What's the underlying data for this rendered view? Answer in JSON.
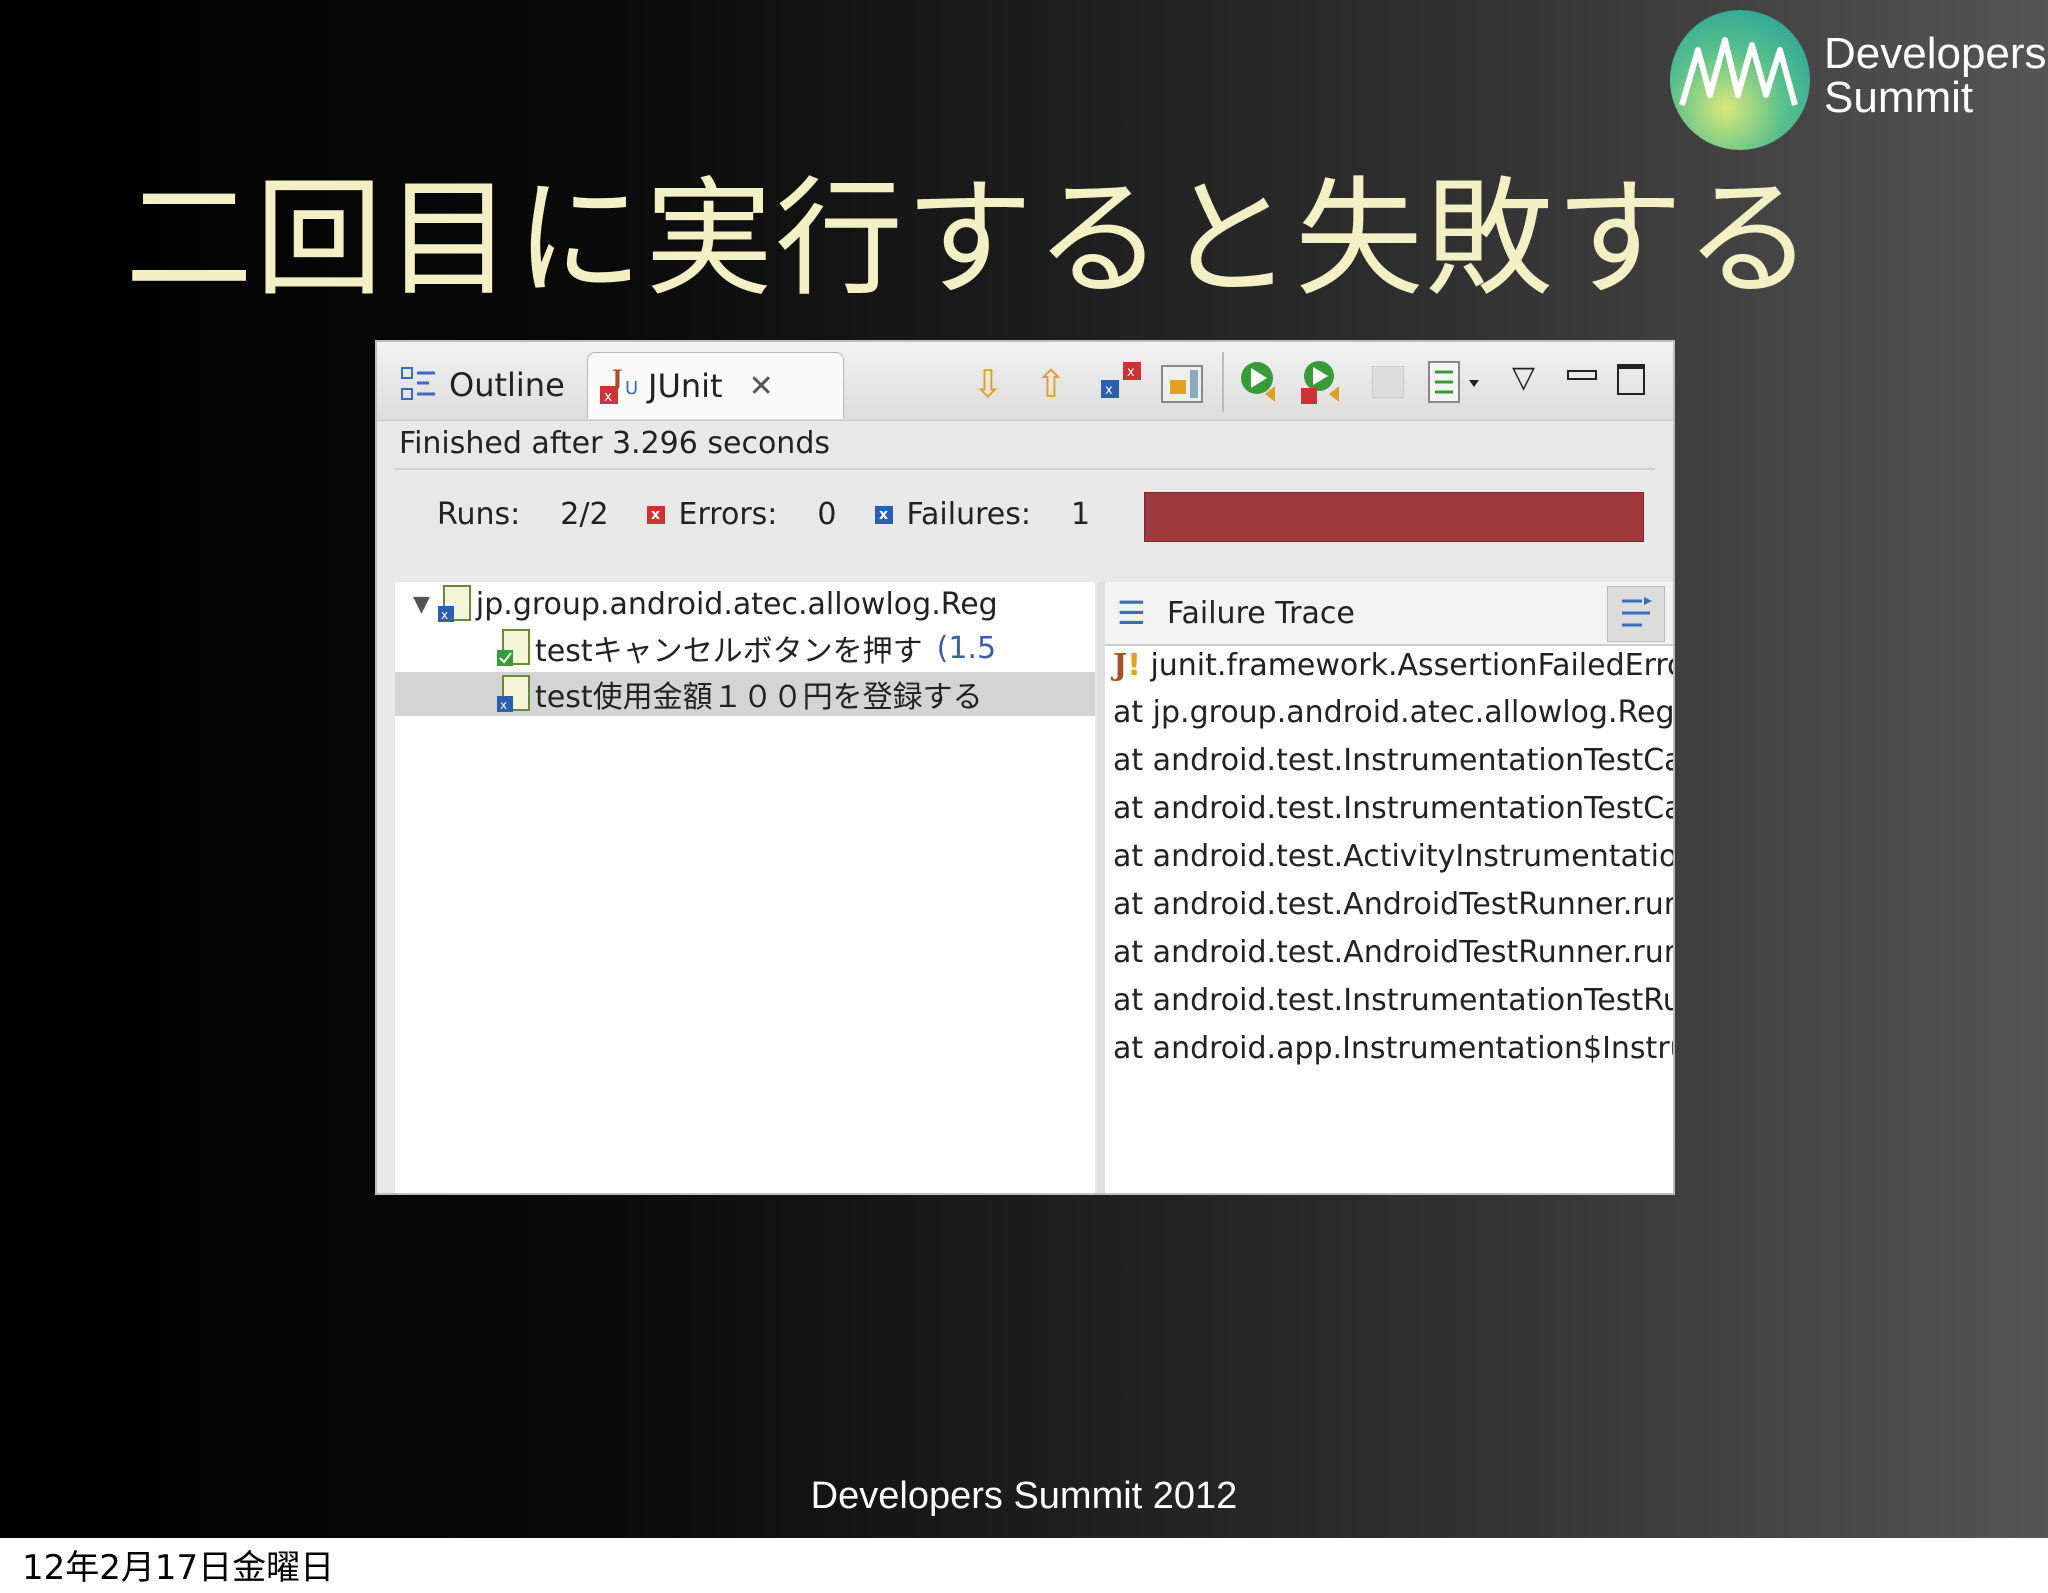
{
  "slide": {
    "title": "二回目に実行すると失敗する",
    "logo_line1": "Developers",
    "logo_line2": "Summit",
    "footer": "Developers Summit 2012",
    "date": "12年2月17日金曜日"
  },
  "panel": {
    "tabs": [
      {
        "label": "Outline",
        "icon": "outline-icon"
      },
      {
        "label": "JUnit",
        "icon": "junit-icon",
        "active": true
      }
    ],
    "status": "Finished after 3.296 seconds",
    "counters": {
      "runs_label": "Runs:",
      "runs_value": "2/2",
      "errors_label": "Errors:",
      "errors_value": "0",
      "failures_label": "Failures:",
      "failures_value": "1"
    },
    "progress": {
      "color": "#9e3a3e",
      "fraction": 1.0
    },
    "tree": [
      {
        "label": "jp.group.android.atec.allowlog.Reg",
        "type": "suite"
      },
      {
        "label": "testキャンセルボタンを押す",
        "time": "(1.5",
        "status": "pass"
      },
      {
        "label": "test使用金額１００円を登録する",
        "status": "fail",
        "selected": true
      }
    ],
    "failure_trace": {
      "title": "Failure Trace",
      "lines": [
        "junit.framework.AssertionFailedError:",
        "at jp.group.android.atec.allowlog.Registe",
        "at android.test.InstrumentationTestCase.",
        "at android.test.InstrumentationTestCase.",
        "at android.test.ActivityInstrumentationTe",
        "at android.test.AndroidTestRunner.runTe",
        "at android.test.AndroidTestRunner.runTe",
        "at android.test.InstrumentationTestRunn",
        "at android.app.Instrumentation$Instrume"
      ]
    }
  }
}
